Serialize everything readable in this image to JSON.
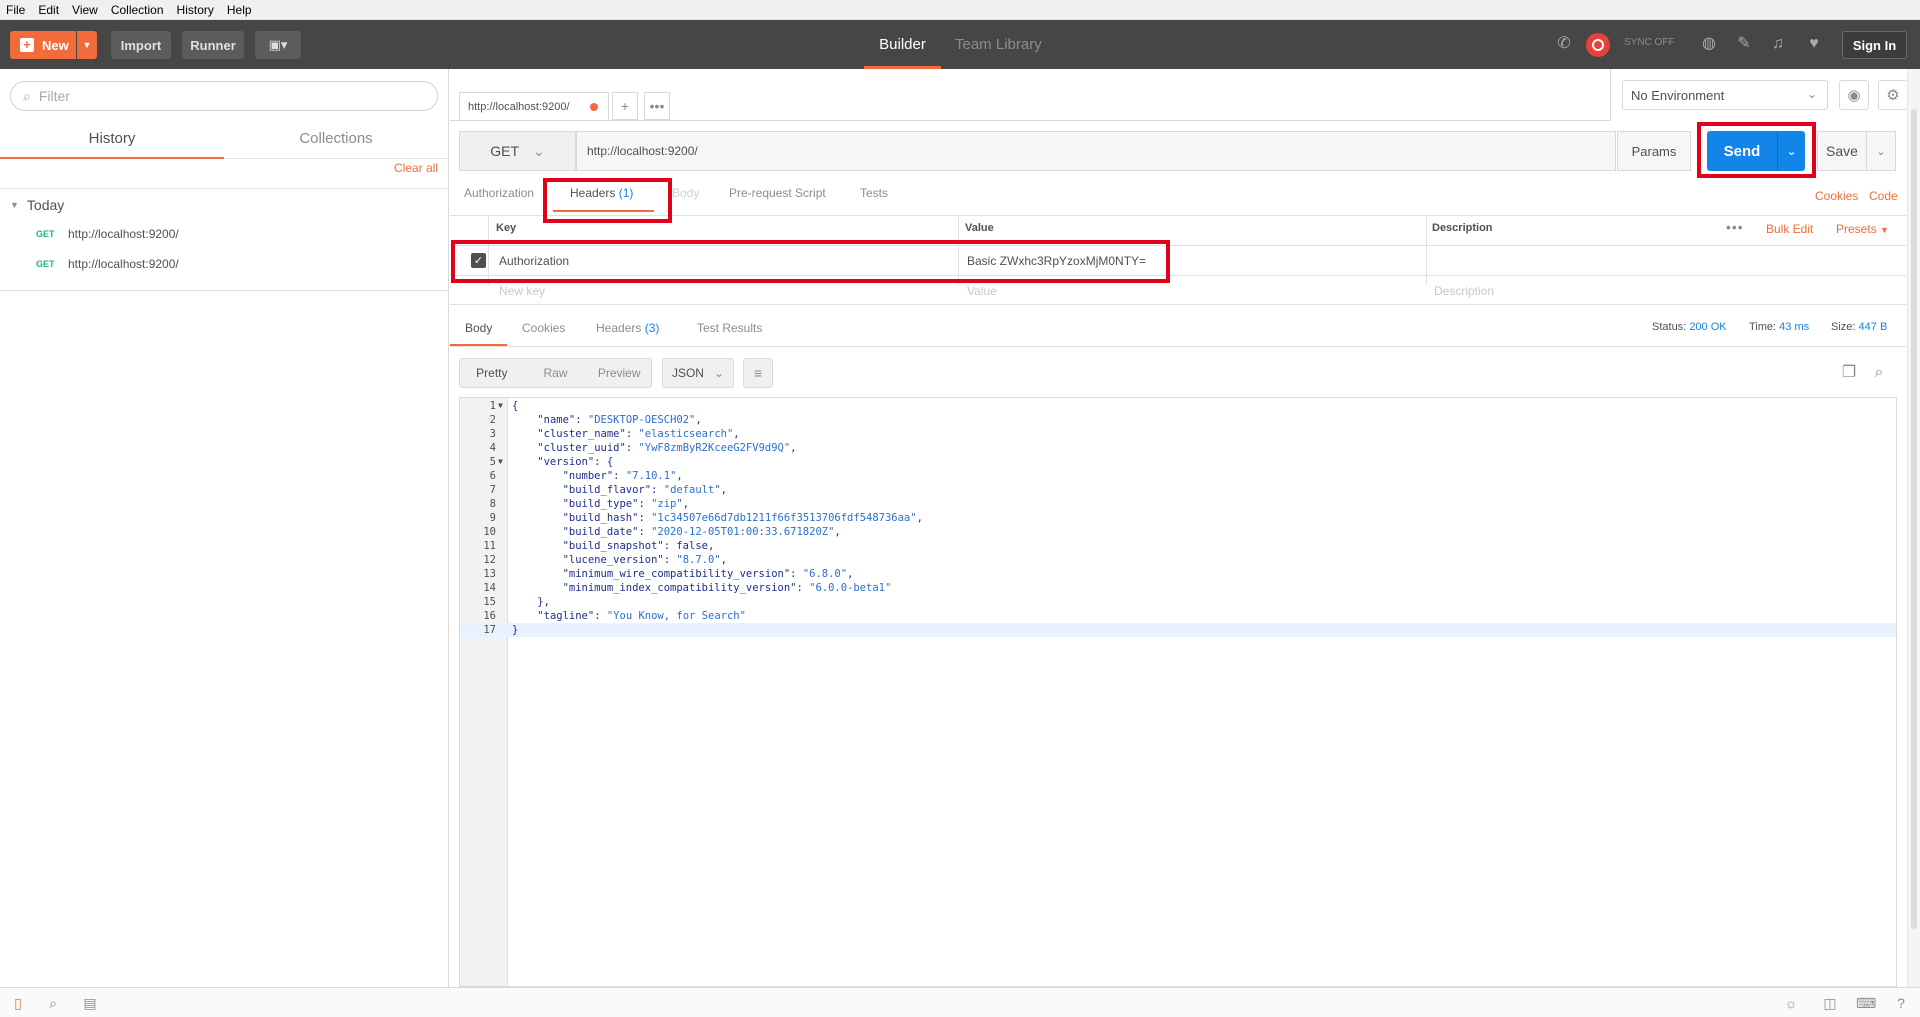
{
  "menu": [
    "File",
    "Edit",
    "View",
    "Collection",
    "History",
    "Help"
  ],
  "toolbar": {
    "new_label": "New",
    "import_label": "Import",
    "runner_label": "Runner",
    "tab_builder": "Builder",
    "tab_team_library": "Team Library",
    "sync_label": "SYNC OFF",
    "signin_label": "Sign In"
  },
  "sidebar": {
    "filter_placeholder": "Filter",
    "tab_history": "History",
    "tab_collections": "Collections",
    "clear_all": "Clear all",
    "group_label": "Today",
    "items": [
      {
        "method": "GET",
        "url": "http://localhost:9200/"
      },
      {
        "method": "GET",
        "url": "http://localhost:9200/"
      }
    ]
  },
  "request": {
    "tab_title": "http://localhost:9200/",
    "method": "GET",
    "url": "http://localhost:9200/",
    "params_label": "Params",
    "send_label": "Send",
    "save_label": "Save",
    "environment": "No Environment",
    "subtabs": {
      "authorization": "Authorization",
      "headers": "Headers",
      "headers_count": "(1)",
      "body": "Body",
      "prerequest": "Pre-request Script",
      "tests": "Tests"
    },
    "cookies_link": "Cookies",
    "code_link": "Code",
    "headers_table": {
      "col_key": "Key",
      "col_value": "Value",
      "col_description": "Description",
      "bulk_edit": "Bulk Edit",
      "presets": "Presets",
      "row": {
        "key": "Authorization",
        "value": "Basic ZWxhc3RpYzoxMjM0NTY=",
        "enabled": true
      },
      "new_key_placeholder": "New key",
      "value_placeholder": "Value",
      "description_placeholder": "Description"
    }
  },
  "response": {
    "tabs": {
      "body": "Body",
      "cookies": "Cookies",
      "headers": "Headers",
      "headers_count": "(3)",
      "test_results": "Test Results"
    },
    "status_label": "Status:",
    "status_value": "200 OK",
    "time_label": "Time:",
    "time_value": "43 ms",
    "size_label": "Size:",
    "size_value": "447 B",
    "view_modes": [
      "Pretty",
      "Raw",
      "Preview"
    ],
    "format": "JSON",
    "lines": [
      "{",
      "    \"name\": \"DESKTOP-OESCH02\",",
      "    \"cluster_name\": \"elasticsearch\",",
      "    \"cluster_uuid\": \"YwF8zmByR2KceeG2FV9d9Q\",",
      "    \"version\": {",
      "        \"number\": \"7.10.1\",",
      "        \"build_flavor\": \"default\",",
      "        \"build_type\": \"zip\",",
      "        \"build_hash\": \"1c34507e66d7db1211f66f3513706fdf548736aa\",",
      "        \"build_date\": \"2020-12-05T01:00:33.671820Z\",",
      "        \"build_snapshot\": false,",
      "        \"lucene_version\": \"8.7.0\",",
      "        \"minimum_wire_compatibility_version\": \"6.8.0\",",
      "        \"minimum_index_compatibility_version\": \"6.0.0-beta1\"",
      "    },",
      "    \"tagline\": \"You Know, for Search\"",
      "}"
    ]
  },
  "colors": {
    "accent": "#f26b3a",
    "send": "#1385e8",
    "highlight_box": "#e3001b",
    "toolbar_bg": "#464646"
  }
}
